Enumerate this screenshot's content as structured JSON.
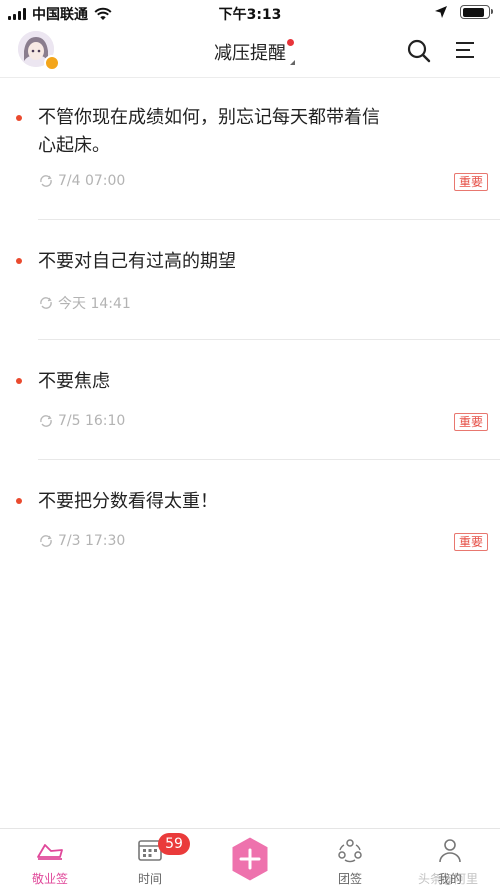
{
  "status_bar": {
    "carrier": "中国联通",
    "time": "下午3:13",
    "battery_level": 0.85
  },
  "header": {
    "title": "减压提醒"
  },
  "reminders": [
    {
      "text": "不管你现在成绩如何，别忘记每天都带着信心起床。",
      "time": "7/4 07:00",
      "tag": "重要"
    },
    {
      "text": "不要对自己有过高的期望",
      "time": "今天 14:41",
      "tag": ""
    },
    {
      "text": "不要焦虑",
      "time": "7/5 16:10",
      "tag": "重要"
    },
    {
      "text": "不要把分数看得太重！",
      "time": "7/3 17:30",
      "tag": "重要"
    }
  ],
  "tabbar": {
    "tabs": [
      {
        "label": "敬业签",
        "icon": "sign-icon",
        "active": true
      },
      {
        "label": "时间",
        "icon": "calendar-icon",
        "active": false
      },
      {
        "label": "团签",
        "icon": "team-icon",
        "active": false
      },
      {
        "label": "我的",
        "icon": "user-icon",
        "active": false
      }
    ],
    "time_badge": "59"
  },
  "watermark": "头条@阿里",
  "colors": {
    "accent": "#e0489a",
    "dot": "#ea4a2e",
    "tag": "#e65047",
    "badge": "#ea3b3b"
  }
}
